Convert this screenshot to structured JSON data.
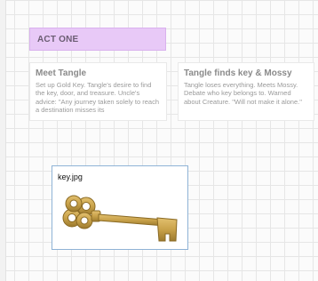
{
  "act": {
    "label": "ACT ONE"
  },
  "cards": [
    {
      "title": "Meet Tangle",
      "body": "Set up Gold Key. Tangle's desire to find the key, door, and treasure. Uncle's advice: \"Any journey taken solely to reach a destination misses its"
    },
    {
      "title": "Tangle finds key & Mossy",
      "body": "Tangle loses everything. Meets Mossy. Debate who key belongs to. Warned about Creature. \"Will not make it alone.\""
    }
  ],
  "image_card": {
    "filename": "key.jpg",
    "image_icon": "gold-key-icon"
  },
  "colors": {
    "act_header": "#e8c9f7",
    "image_border": "#8fb3d6",
    "key_gold": "#c9a24a"
  }
}
